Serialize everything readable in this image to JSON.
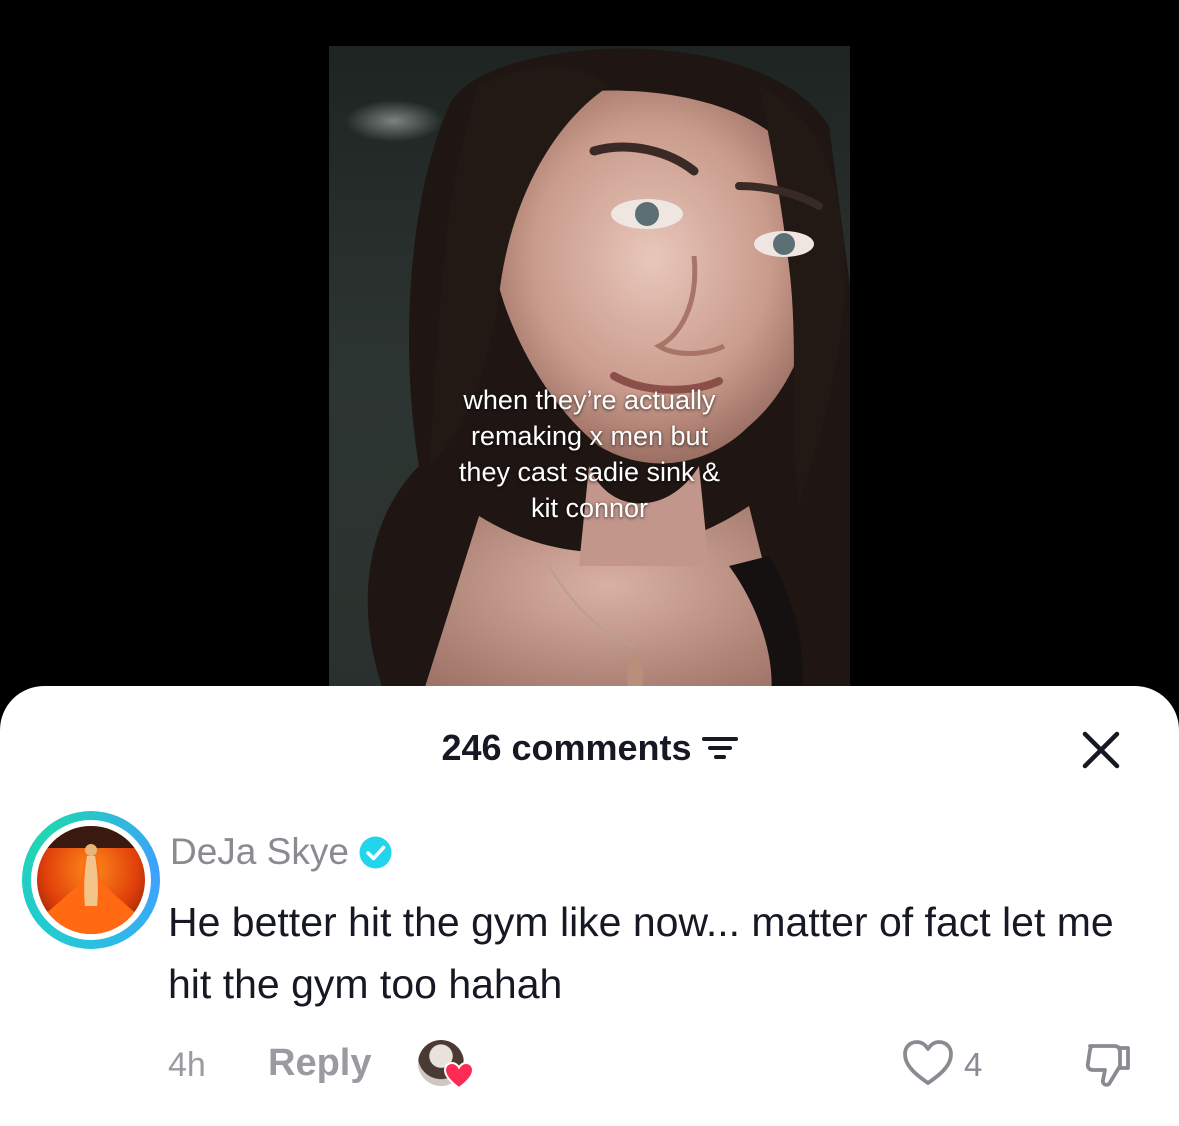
{
  "video": {
    "caption_lines": [
      "when they’re actually",
      "remaking x men but",
      "they cast sadie sink &",
      "kit connor"
    ]
  },
  "comments_sheet": {
    "count_label": "246 comments",
    "filter_icon": "sort-filter-icon",
    "close_icon": "close-x-icon"
  },
  "comment": {
    "username": "DeJa Skye",
    "verified_icon": "verified-check-icon",
    "text": "He better hit the gym like now... matter of fact let me hit the gym too hahah",
    "time": "4h",
    "reply_label": "Reply",
    "like_count": "4",
    "colors": {
      "avatar_ring": "#25c7d9",
      "verified": "#20d5ec",
      "heart": "#fe2c55"
    }
  }
}
